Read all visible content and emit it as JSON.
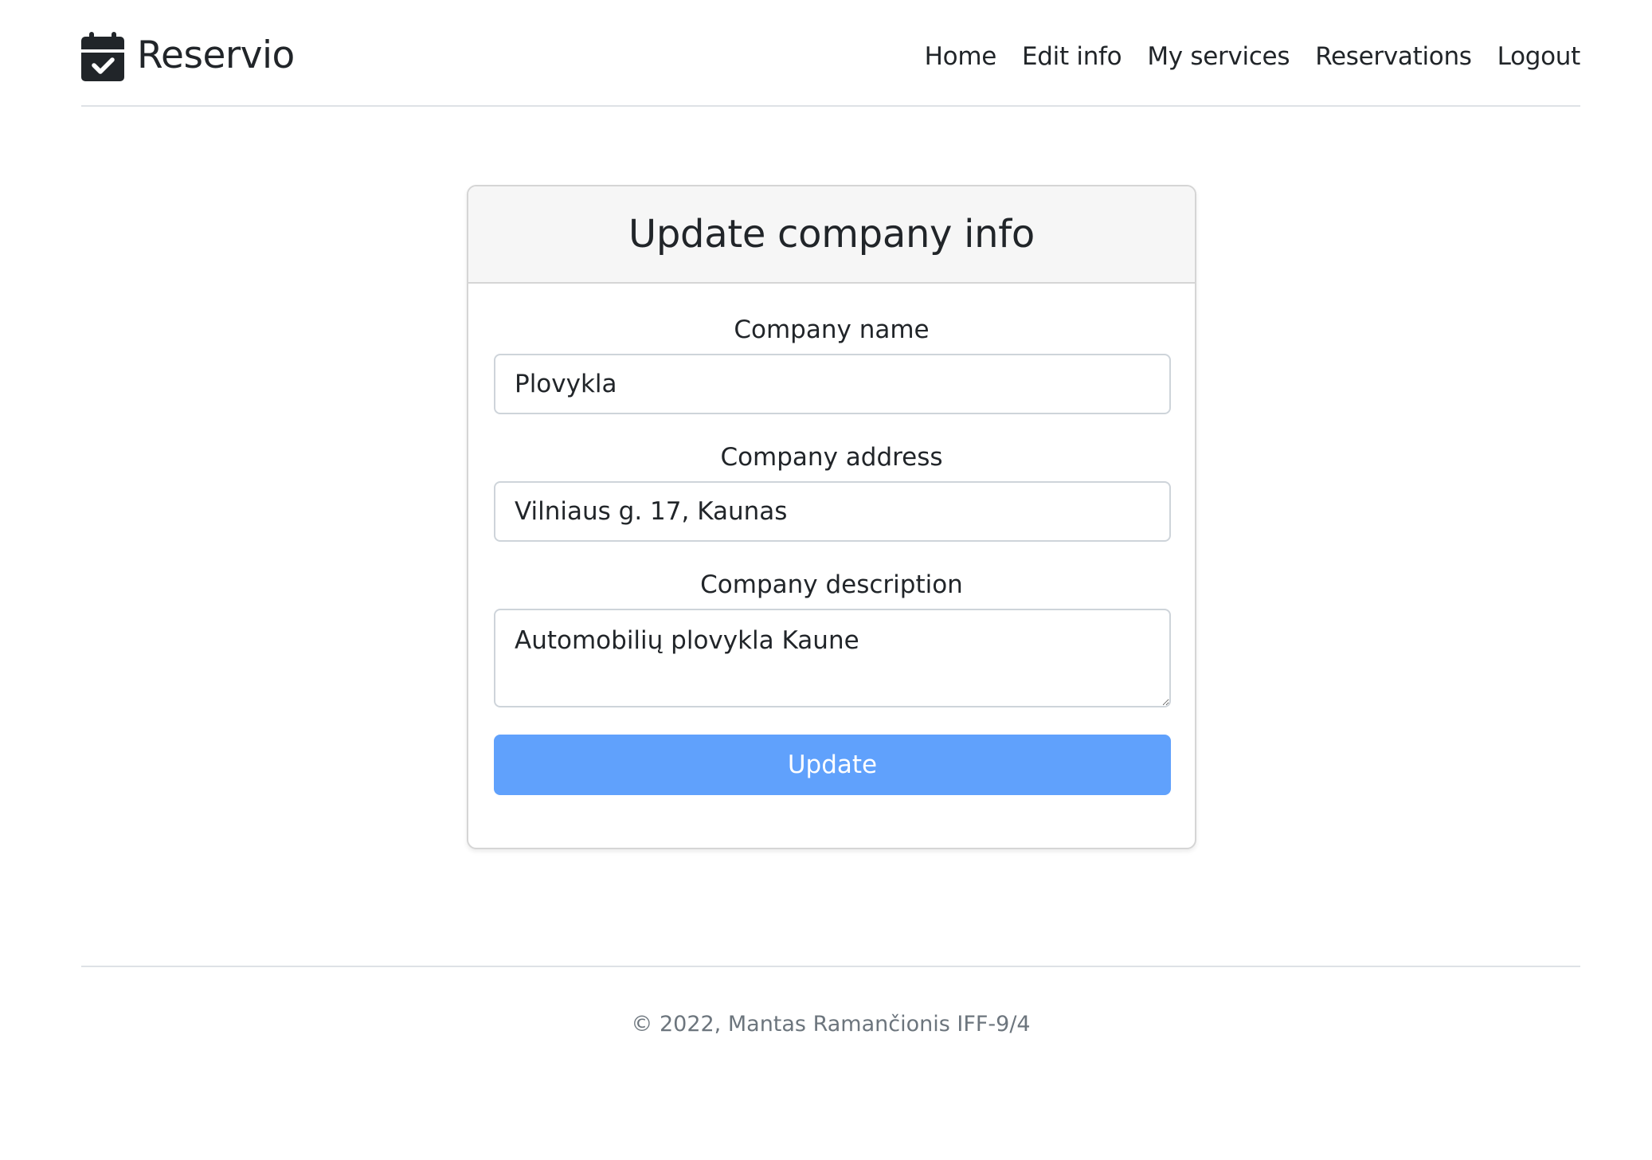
{
  "brand": {
    "name": "Reservio",
    "icon": "calendar-check-icon"
  },
  "nav": {
    "items": [
      {
        "label": "Home"
      },
      {
        "label": "Edit info"
      },
      {
        "label": "My services"
      },
      {
        "label": "Reservations"
      },
      {
        "label": "Logout"
      }
    ]
  },
  "form": {
    "title": "Update company info",
    "name_label": "Company name",
    "name_value": "Plovykla",
    "address_label": "Company address",
    "address_value": "Vilniaus g. 17, Kaunas",
    "description_label": "Company description",
    "description_value": "Automobilių plovykla Kaune",
    "submit_label": "Update"
  },
  "footer": {
    "text": "© 2022, Mantas Ramančionis IFF-9/4"
  },
  "colors": {
    "button": "#60a1fc",
    "text": "#212529",
    "muted": "#6c757d"
  }
}
